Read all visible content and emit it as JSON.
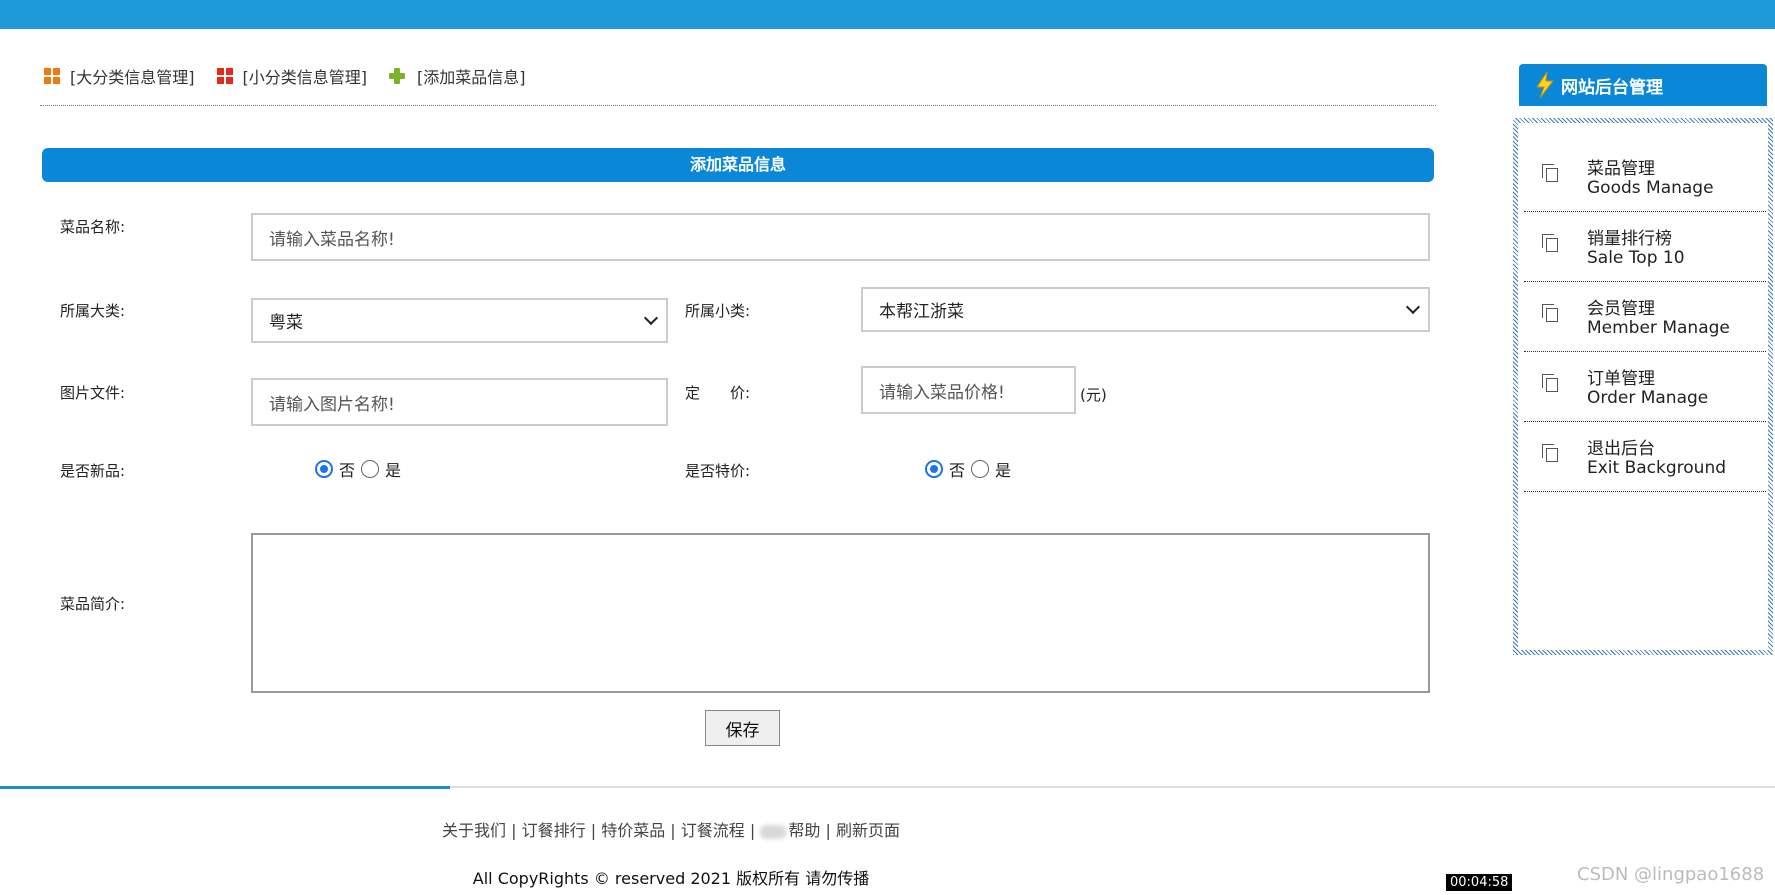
{
  "topnav": {
    "items": [
      {
        "label": "[大分类信息管理]"
      },
      {
        "label": "[小分类信息管理]"
      },
      {
        "label": "[添加菜品信息]"
      }
    ]
  },
  "form": {
    "title": "添加菜品信息",
    "name_label": "菜品名称:",
    "name_placeholder": "请输入菜品名称!",
    "bigcat_label": "所属大类:",
    "bigcat_value": "粤菜",
    "smallcat_label": "所属小类:",
    "smallcat_value": "本帮江浙菜",
    "image_label": "图片文件:",
    "image_placeholder": "请输入图片名称!",
    "price_label": "定　　价:",
    "price_placeholder": "请输入菜品价格!",
    "price_unit": "(元)",
    "isnew_label": "是否新品:",
    "isspecial_label": "是否特价:",
    "opt_no": "否",
    "opt_yes": "是",
    "isnew_selected": "否",
    "isspecial_selected": "否",
    "desc_label": "菜品简介:",
    "desc_value": "",
    "save_label": "保存"
  },
  "sidebar": {
    "title": "网站后台管理",
    "items": [
      {
        "zh": "菜品管理",
        "en": "Goods Manage"
      },
      {
        "zh": "销量排行榜",
        "en": "Sale Top 10"
      },
      {
        "zh": "会员管理",
        "en": "Member Manage"
      },
      {
        "zh": "订单管理",
        "en": "Order Manage"
      },
      {
        "zh": "退出后台",
        "en": "Exit Background"
      }
    ]
  },
  "footer": {
    "links": [
      "关于我们",
      "订餐排行",
      "特价菜品",
      "订餐流程",
      "帮助",
      "刷新页面"
    ],
    "separator": " | ",
    "copyright": "All CopyRights © reserved 2021 版权所有 请勿传播"
  },
  "overlay": {
    "timestamp": "00:04:58",
    "watermark": "CSDN @lingpao1688"
  },
  "colors": {
    "brand_blue": "#0a87d6",
    "topbar_blue": "#1e9ad8",
    "radio_blue": "#1a73e8"
  }
}
